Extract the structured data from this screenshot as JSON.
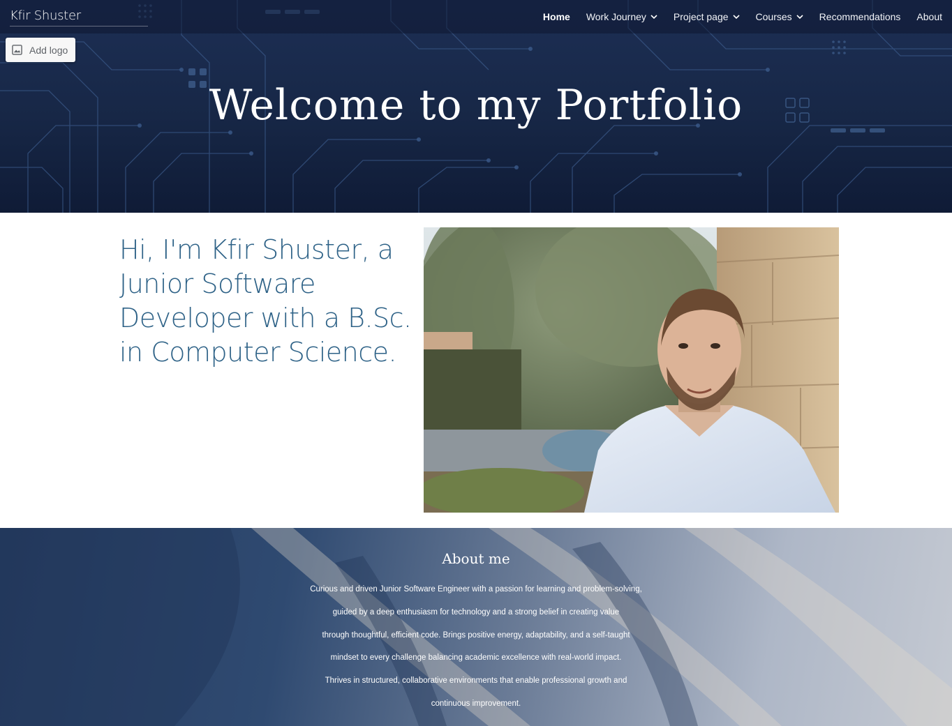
{
  "header": {
    "site_title": "Kfir Shuster",
    "add_logo_label": "Add logo",
    "nav": [
      {
        "label": "Home",
        "active": true,
        "has_dropdown": false
      },
      {
        "label": "Work Journey",
        "active": false,
        "has_dropdown": true
      },
      {
        "label": "Project page",
        "active": false,
        "has_dropdown": true
      },
      {
        "label": "Courses",
        "active": false,
        "has_dropdown": true
      },
      {
        "label": "Recommendations",
        "active": false,
        "has_dropdown": false
      },
      {
        "label": "About",
        "active": false,
        "has_dropdown": false
      }
    ]
  },
  "hero": {
    "title": "Welcome to my Portfolio"
  },
  "intro": {
    "text": "Hi, I'm Kfir Shuster, a Junior Software Developer with a B.Sc. in Computer Science."
  },
  "about": {
    "title": "About me",
    "lines": [
      "Curious and driven Junior Software Engineer with a passion for learning and problem-solving,",
      "guided by a deep enthusiasm for technology and a strong belief in creating value",
      "through thoughtful, efficient code. Brings positive energy, adaptability, and a self-taught",
      "mindset to every challenge balancing academic excellence with real-world impact.",
      "Thrives in structured, collaborative environments that enable professional growth and",
      "continuous improvement."
    ]
  },
  "colors": {
    "intro_text": "#2e6287",
    "hero_bg": "#172746",
    "about_bg": "#2f4a71"
  }
}
